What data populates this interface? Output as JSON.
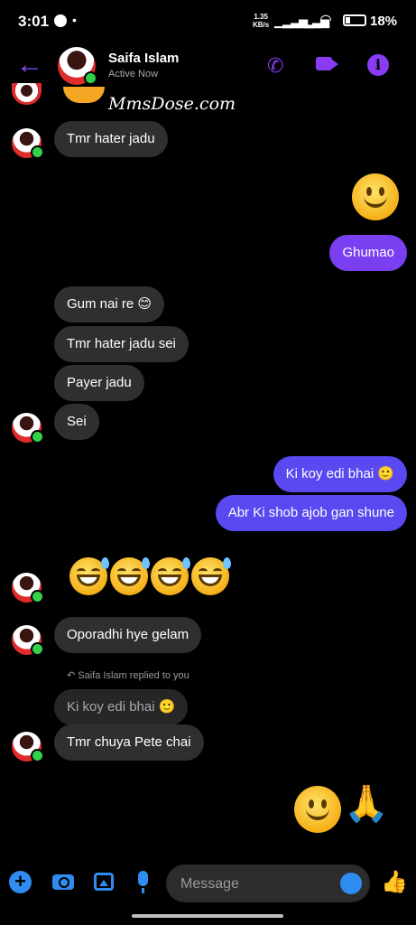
{
  "status": {
    "time": "3:01",
    "dot": "•",
    "speed_top": "1.35",
    "speed_bottom": "KB/s",
    "battery": "18%"
  },
  "header": {
    "back_icon": "arrow-left-icon",
    "name": "Saifa Islam",
    "presence": "Active Now",
    "accent": "#8a3cf5"
  },
  "watermark": "MmsDose.com",
  "messages": {
    "m1": "Tmr hater jadu",
    "m2": "Ghumao",
    "m3": "Gum nai re 😊",
    "m4": "Tmr hater jadu sei",
    "m5": "Payer jadu",
    "m6": "Sei",
    "m7": "Ki koy edi bhai 🙂",
    "m8": "Abr Ki shob ajob gan shune",
    "m9": "Oporadhi hye gelam",
    "reply_label": "Saifa Islam replied to you",
    "quoted": "Ki koy edi bhai 🙂",
    "m10": "Tmr chuya Pete chai"
  },
  "colors": {
    "incoming": "#2f2f2f",
    "outgoing_purple": "#7b3ff2",
    "outgoing_blue": "#5a48f0",
    "composer_blue": "#2f8cf0"
  },
  "composer": {
    "placeholder": "Message"
  }
}
